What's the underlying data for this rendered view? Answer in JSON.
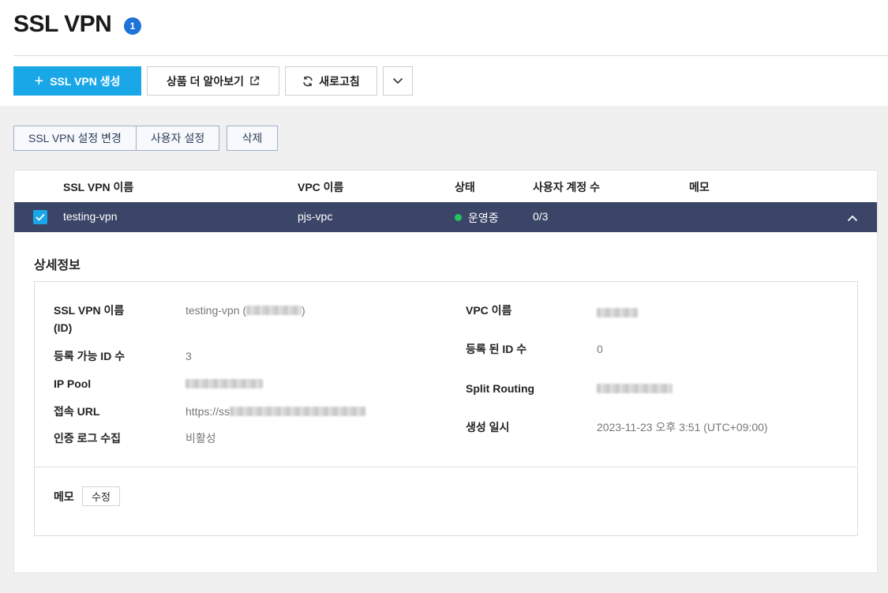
{
  "header": {
    "title": "SSL VPN",
    "badge": "1"
  },
  "toolbar": {
    "create_label": "SSL VPN 생성",
    "create_icon": "plus-icon",
    "learn_label": "상품 더 알아보기",
    "learn_icon": "external-link-icon",
    "refresh_label": "새로고침",
    "refresh_icon": "refresh-icon",
    "more_icon": "chevron-down-icon"
  },
  "actions": {
    "change_settings": "SSL VPN 설정 변경",
    "user_settings": "사용자 설정",
    "delete": "삭제"
  },
  "table": {
    "columns": [
      "SSL VPN 이름",
      "VPC 이름",
      "상태",
      "사용자 계정 수",
      "메모"
    ],
    "rows": [
      {
        "selected": true,
        "name": "testing-vpn",
        "vpc": "pjs-vpc",
        "status": "운영중",
        "user_count": "0/3",
        "memo": ""
      }
    ]
  },
  "detail": {
    "title": "상세정보",
    "ssl_vpn_name_label_line1": "SSL VPN 이름",
    "ssl_vpn_name_label_line2": "(ID)",
    "ssl_vpn_name_value": "testing-vpn (",
    "ssl_vpn_name_value_end": ")",
    "max_id_label": "등록 가능 ID 수",
    "max_id_value": "3",
    "ip_pool_label": "IP Pool",
    "url_label": "접속 URL",
    "url_value": "https://ss",
    "auth_log_label": "인증 로그 수집",
    "auth_log_value": "비활성",
    "vpc_name_label": "VPC 이름",
    "registered_id_label": "등록 된 ID 수",
    "registered_id_value": "0",
    "split_routing_label": "Split Routing",
    "created_label": "생성 일시",
    "created_value": "2023-11-23 오후 3:51 (UTC+09:00)",
    "memo_label": "메모",
    "memo_edit_label": "수정"
  },
  "colors": {
    "primary": "#1aa7e8",
    "selected_row": "#3b4567",
    "status_running": "#22c55e",
    "badge": "#1e73d8"
  }
}
